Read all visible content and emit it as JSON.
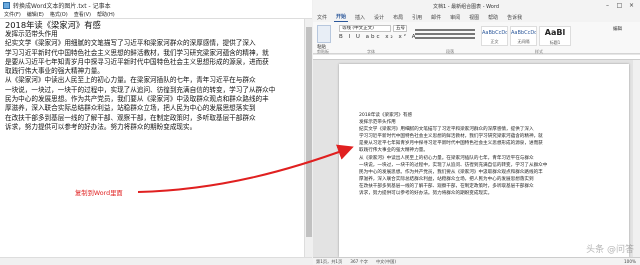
{
  "notepad": {
    "title": "转换成Word文本的图片.txt - 记事本",
    "menus": [
      "文件(F)",
      "编辑(E)",
      "格式(O)",
      "查看(V)",
      "帮助(H)"
    ],
    "lines": [
      "2018年读《梁家河》有感",
      "发挥示范带头作用",
      "纪实文学《梁家河》用细腻的文笔描写了习近平和梁家河群众的深厚感情，提供了深入",
      "学习习近平新时代中国特色社会主义思想的鲜活教材，我们学习研究梁家河蕴含的精神，就",
      "是要从习近平七年知青岁月中探寻习近平新时代中国特色社会主义思想形成的源泉，进而获",
      "取践行伟大事业的强大精神力量。",
      "从《梁家河》中读出人民至上的初心力量。在梁家河插队的七年，青年习近平在与群众",
      "一块说，一块过，一块干的过程中，实现了从追问、彷徨到充满自信的转变，学习了从群众中",
      "民为中心的发展思想。作为共产党员，我们要从《梁家河》中汲取群众观点和群众路线的丰",
      "厚滋养，深入联合实际总结群众利益，站稳群众立场，把人民为中心的发展思想落实到",
      "在改扶干部多到基层一线的了解干部、观察干部，在制定政策时，多听取基层干部群众",
      "诉求，努力提供可以参考的好办法。努力将群众的期盼变成现实。"
    ],
    "annotation": "复制到Word里面"
  },
  "word": {
    "title": "文档1 - 最新组合图表 - Word",
    "tabs": [
      "文件",
      "开始",
      "插入",
      "设计",
      "布局",
      "引用",
      "邮件",
      "审阅",
      "视图",
      "帮助",
      "告诉我"
    ],
    "active_tab": "开始",
    "font_name": "等线 (中文正文)",
    "font_size": "五号",
    "format_buttons": "B I U abc x₂ x² A",
    "paste_label": "粘贴",
    "groups": [
      "剪贴板",
      "字体",
      "段落",
      "样式"
    ],
    "styles": [
      {
        "preview": "AaBbCcDd",
        "name": "正文"
      },
      {
        "preview": "AaBbCcDd",
        "name": "无间隔"
      },
      {
        "preview": "AaBl",
        "name": "标题1"
      }
    ],
    "edit_label": "编辑",
    "doc_lines": [
      "2018年读《梁家河》有感",
      "发挥示范带头作用",
      "纪实文学《梁家河》用细腻的文笔描写了习近平和梁家河群众的深厚感情，提供了深入",
      "学习习近平新时代中国特色社会主义思想的鲜活教材，我们学习研究梁家河蕴含的精神，就",
      "是要从习近平七年知青岁月中探寻习近平新时代中国特色社会主义思想形成的源泉，进而获",
      "取践行伟大事业的强大精神力量。",
      "从《梁家河》中读出人民至上的初心力量。在梁家河插队的七年，青年习近平在与群众",
      "一块说，一块过，一块干的过程中，实现了从追问、彷徨到充满自信的转变，学习了从群众中",
      "民为中心的发展思想。作为共产党员，我们要从《梁家河》中汲取群众观点和群众路线的丰",
      "厚滋养，深入联合实际总结群众利益，站稳群众立场，把人民为中心的发展思想落实到",
      "在改扶干部多到基层一线的了解干部、观察干部，在制定政策时，多听取基层干部群众",
      "诉求，努力提供可以参考的好办法。努力将群众的期盼变成现实。"
    ],
    "status": [
      "第1页，共1页",
      "367 个字",
      "中文(中国)"
    ],
    "zoom": "100%"
  },
  "watermark": "头条 @问答"
}
